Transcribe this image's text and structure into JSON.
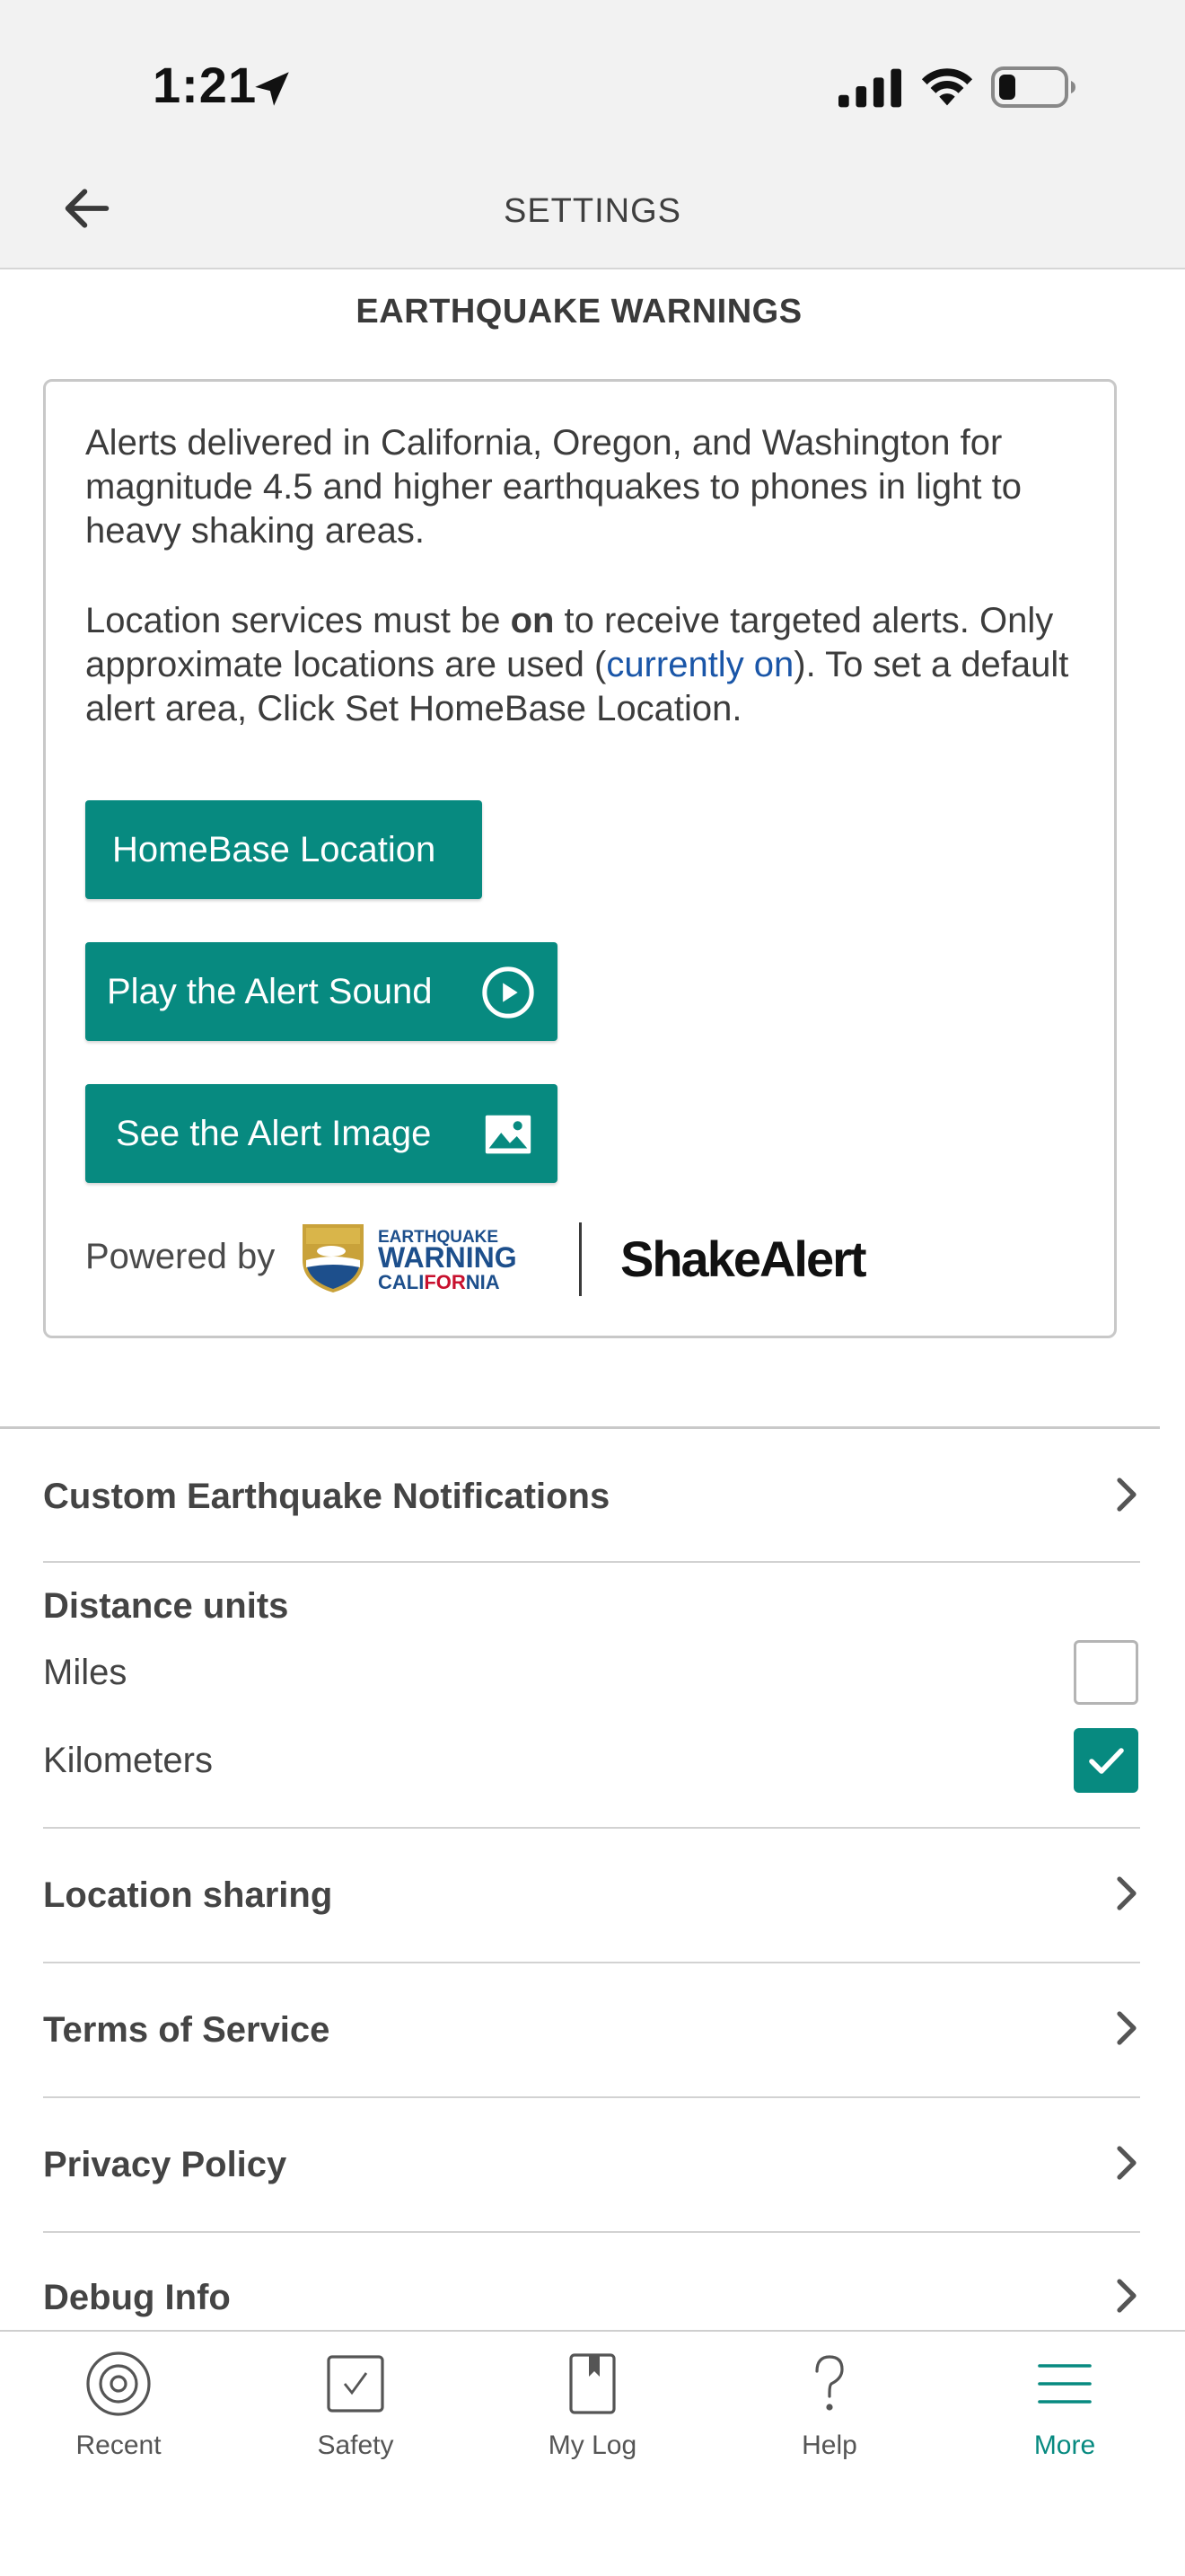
{
  "status_bar": {
    "time": "1:21"
  },
  "header": {
    "title": "SETTINGS"
  },
  "section": {
    "title": "EARTHQUAKE WARNINGS"
  },
  "card": {
    "paragraph1": "Alerts delivered in California, Oregon, and Washington for magnitude 4.5 and higher earthquakes to phones in light to heavy shaking areas.",
    "p2_part1": "Location services must be ",
    "p2_bold": "on",
    "p2_part2": " to receive targeted alerts. Only approximate locations are used (",
    "p2_link": "currently on",
    "p2_part3": "). To set a default alert area, Click Set HomeBase Location.",
    "homebase_button": "HomeBase Location",
    "sound_button": "Play the Alert Sound",
    "image_button": "See the Alert Image",
    "powered_by": "Powered by",
    "ewc_logo": {
      "line1": "EARTHQUAKE",
      "line2": "WARNING",
      "line3a": "CALI",
      "line3b": "FOR",
      "line3c": "NIA"
    },
    "shakealert_logo": "ShakeAlert"
  },
  "settings": {
    "custom_notifications": "Custom Earthquake Notifications",
    "distance_units_label": "Distance units",
    "miles": "Miles",
    "kilometers": "Kilometers",
    "miles_checked": false,
    "kilometers_checked": true,
    "location_sharing": "Location sharing",
    "terms": "Terms of Service",
    "privacy": "Privacy Policy",
    "debug": "Debug Info"
  },
  "tabs": [
    {
      "label": "Recent",
      "icon": "target-icon",
      "active": false
    },
    {
      "label": "Safety",
      "icon": "checkbox-icon",
      "active": false
    },
    {
      "label": "My Log",
      "icon": "book-icon",
      "active": false
    },
    {
      "label": "Help",
      "icon": "question-icon",
      "active": false
    },
    {
      "label": "More",
      "icon": "menu-icon",
      "active": true
    }
  ],
  "colors": {
    "accent": "#078a80",
    "link": "#1a56a8"
  }
}
